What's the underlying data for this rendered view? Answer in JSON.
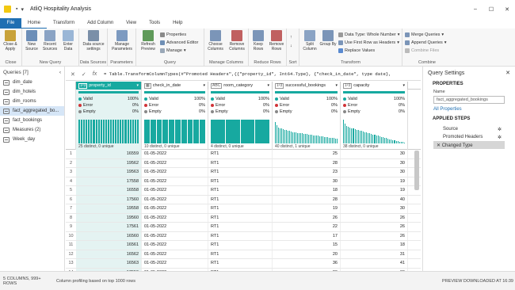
{
  "window": {
    "title": "AtliQ Hospitality Analysis"
  },
  "tabs": [
    "File",
    "Home",
    "Transform",
    "Add Column",
    "View",
    "Tools",
    "Help"
  ],
  "ribbon": {
    "close_apply": "Close & Apply",
    "close_group": "Close",
    "new_source": "New Source",
    "recent_sources": "Recent Sources",
    "enter_data": "Enter Data",
    "new_query_group": "New Query",
    "data_source_settings": "Data source settings",
    "data_sources_group": "Data Sources",
    "manage_parameters": "Manage Parameters",
    "parameters_group": "Parameters",
    "refresh_preview": "Refresh Preview",
    "properties": "Properties",
    "advanced_editor": "Advanced Editor",
    "manage": "Manage",
    "query_group": "Query",
    "choose_columns": "Choose Columns",
    "remove_columns": "Remove Columns",
    "manage_columns_group": "Manage Columns",
    "keep_rows": "Keep Rows",
    "remove_rows": "Remove Rows",
    "reduce_rows_group": "Reduce Rows",
    "sort_group": "Sort",
    "split_column": "Split Column",
    "group_by": "Group By",
    "data_type": "Data Type: Whole Number",
    "first_row_headers": "Use First Row as Headers",
    "replace_values": "Replace Values",
    "transform_group": "Transform",
    "merge_queries": "Merge Queries",
    "append_queries": "Append Queries",
    "combine_files": "Combine Files",
    "combine_group": "Combine"
  },
  "queries": {
    "header": "Queries [7]",
    "items": [
      "dim_date",
      "dim_hotels",
      "dim_rooms",
      "fact_aggregated_bo...",
      "fact_bookings",
      "Measures (2)",
      "Week_day"
    ],
    "selected_index": 3
  },
  "formula": "= Table.TransformColumnTypes(#\"Promoted Headers\",{{\"property_id\", Int64.Type}, {\"check_in_date\", type date},",
  "columns": [
    {
      "type": "1²3",
      "name": "property_id"
    },
    {
      "type": "▦",
      "name": "check_in_date"
    },
    {
      "type": "ABC",
      "name": "room_category"
    },
    {
      "type": "1²3",
      "name": "successful_bookings"
    },
    {
      "type": "1²3",
      "name": "capacity"
    }
  ],
  "profile_labels": {
    "valid": "Valid",
    "error": "Error",
    "empty": "Empty"
  },
  "profile_colors": {
    "valid": "#17a9a0",
    "error": "#d13438",
    "empty": "#888888"
  },
  "profiles": [
    {
      "valid": "100%",
      "error": "0%",
      "empty": "0%",
      "distinct": "25 distinct, 0 unique",
      "hist": [
        100,
        100,
        100,
        100,
        100,
        100,
        100,
        100,
        100,
        100,
        100,
        100,
        100,
        100,
        100,
        100,
        100,
        100,
        100,
        100,
        100,
        100,
        100,
        100,
        100
      ]
    },
    {
      "valid": "100%",
      "error": "0%",
      "empty": "0%",
      "distinct": "10 distinct, 0 unique",
      "hist": [
        100,
        100,
        100,
        100,
        100,
        100,
        100,
        100,
        100,
        100
      ]
    },
    {
      "valid": "100%",
      "error": "0%",
      "empty": "0%",
      "distinct": "4 distinct, 0 unique",
      "hist": [
        100,
        100,
        100,
        100
      ]
    },
    {
      "valid": "100%",
      "error": "0%",
      "empty": "0%",
      "distinct": "40 distinct, 1 unique",
      "hist": [
        90,
        76,
        68,
        64,
        62,
        60,
        58,
        56,
        54,
        52,
        50,
        48,
        47,
        46,
        45,
        44,
        43,
        42,
        41,
        40,
        39,
        38,
        37,
        36,
        35,
        34,
        33,
        32,
        31,
        30,
        29,
        28,
        27,
        26,
        25,
        24,
        23,
        22,
        21,
        20
      ]
    },
    {
      "valid": "100%",
      "error": "0%",
      "empty": "0%",
      "distinct": "38 distinct, 0 unique",
      "hist": [
        100,
        82,
        74,
        70,
        66,
        64,
        62,
        60,
        58,
        56,
        54,
        52,
        50,
        48,
        46,
        44,
        42,
        40,
        38,
        36,
        34,
        32,
        30,
        28,
        26,
        24,
        22,
        20,
        18,
        16,
        14,
        12,
        10,
        9,
        8,
        7,
        6,
        5
      ]
    }
  ],
  "rows": [
    [
      "1",
      "16559",
      "01-05-2022",
      "RT1",
      "25",
      "30"
    ],
    [
      "2",
      "19562",
      "01-05-2022",
      "RT1",
      "28",
      "30"
    ],
    [
      "3",
      "19563",
      "01-05-2022",
      "RT1",
      "23",
      "30"
    ],
    [
      "4",
      "17558",
      "01-05-2022",
      "RT1",
      "30",
      "19"
    ],
    [
      "5",
      "16558",
      "01-05-2022",
      "RT1",
      "18",
      "19"
    ],
    [
      "6",
      "17560",
      "01-05-2022",
      "RT1",
      "28",
      "40"
    ],
    [
      "7",
      "19558",
      "01-05-2022",
      "RT1",
      "19",
      "30"
    ],
    [
      "8",
      "19560",
      "01-05-2022",
      "RT1",
      "26",
      "26"
    ],
    [
      "9",
      "17561",
      "01-05-2022",
      "RT1",
      "22",
      "26"
    ],
    [
      "10",
      "16560",
      "01-05-2022",
      "RT1",
      "17",
      "26"
    ],
    [
      "11",
      "16561",
      "01-05-2022",
      "RT1",
      "15",
      "18"
    ],
    [
      "12",
      "16562",
      "01-05-2022",
      "RT1",
      "20",
      "31"
    ],
    [
      "13",
      "16563",
      "01-05-2022",
      "RT1",
      "36",
      "41"
    ],
    [
      "14",
      "17559",
      "01-05-2022",
      "RT1",
      "20",
      "30"
    ],
    [
      "15",
      "17562",
      "01-05-2022",
      "RT1",
      "26",
      "30"
    ]
  ],
  "settings": {
    "title": "Query Settings",
    "properties_header": "PROPERTIES",
    "name_label": "Name",
    "name_value": "fact_aggregated_bookings",
    "all_properties": "All Properties",
    "applied_steps_header": "APPLIED STEPS",
    "steps": [
      "Source",
      "Promoted Headers",
      "Changed Type"
    ]
  },
  "status": {
    "columns_rows": "5 COLUMNS, 999+ ROWS",
    "profiling": "Column profiling based on top 1000 rows",
    "preview": "PREVIEW DOWNLOADED AT 16:39"
  }
}
